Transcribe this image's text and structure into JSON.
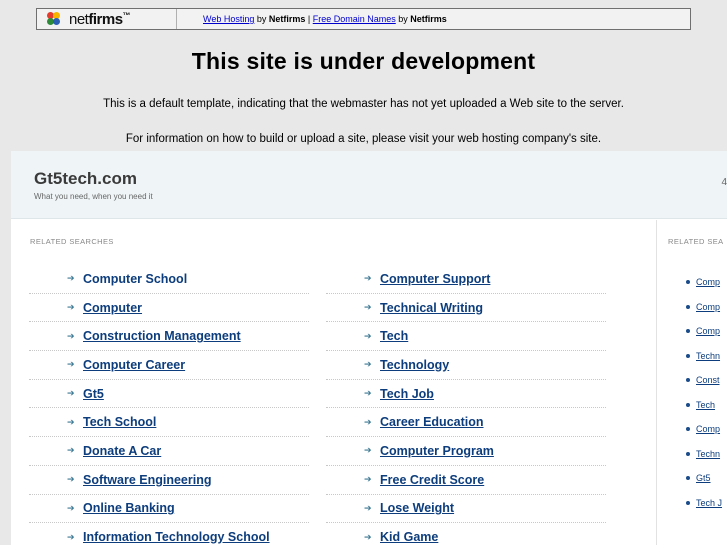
{
  "topbar": {
    "logo_prefix": "net",
    "logo_suffix": "firms",
    "logo_tm": "™",
    "link1": "Web Hosting",
    "by1": " by ",
    "brand1": "Netfirms",
    "separator": " | ",
    "link2": "Free Domain Names",
    "by2": " by ",
    "brand2": "Netfirms"
  },
  "headline": "This site is under development",
  "desc1": "This is a default template, indicating that the webmaster has not yet uploaded a Web site to the server.",
  "desc2": "For information on how to build or upload a site, please visit your web hosting company's site.",
  "panel": {
    "site_title": "Gt5tech.com",
    "site_tagline": "What you need, when you need it",
    "edge_char": "4",
    "related_label": "RELATED SEARCHES",
    "left_items": [
      "Computer School",
      "Computer",
      "Construction Management",
      "Computer Career",
      "Gt5",
      "Tech School",
      "Donate A Car",
      "Software Engineering",
      "Online Banking",
      "Information Technology School"
    ],
    "right_items": [
      "Computer Support",
      "Technical Writing",
      "Tech",
      "Technology",
      "Tech Job",
      "Career Education",
      "Computer Program",
      "Free Credit Score",
      "Lose Weight",
      "Kid Game"
    ],
    "side_label": "RELATED SEA",
    "side_items": [
      "Comp",
      "Comp",
      "Comp",
      "Techn",
      "Const",
      "Tech",
      "Comp",
      "Techn",
      "Gt5",
      "Tech J"
    ]
  },
  "colors": {
    "link": "#0d3d7c",
    "arrow": "#3d7a96",
    "header_bg": "#eff5f7",
    "page_bg": "#e8e8e8"
  },
  "icons": {
    "bullet": "arrow-right-icon",
    "logo": "netfirms-logo-icon"
  }
}
